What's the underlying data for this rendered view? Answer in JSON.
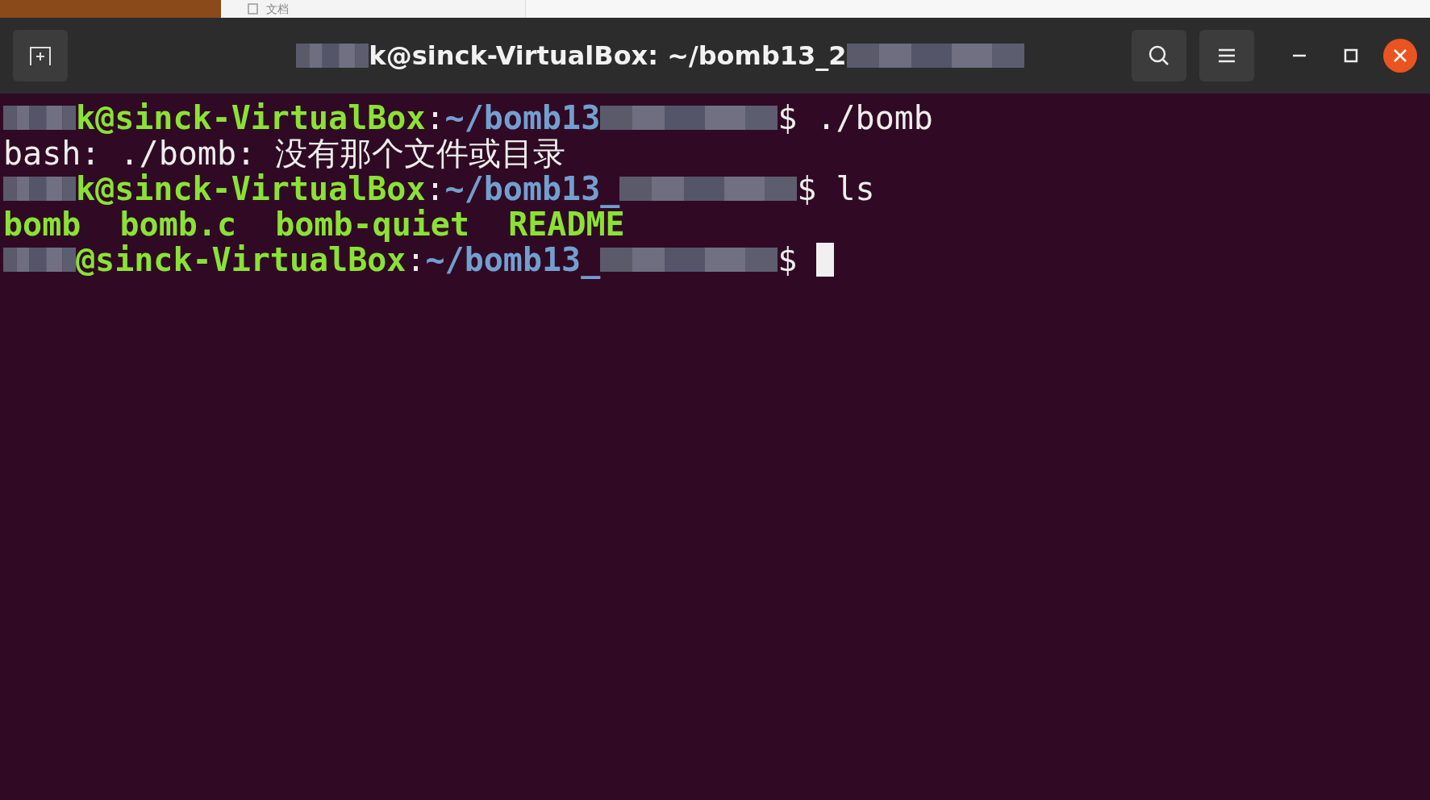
{
  "background_window": {
    "label": "文档"
  },
  "window": {
    "title": [
      {
        "kind": "redaction"
      },
      {
        "kind": "text",
        "text": "k@sinck-VirtualBox: ~/bomb13_2"
      },
      {
        "kind": "redaction"
      }
    ]
  },
  "terminal": {
    "lines": [
      {
        "segments": [
          {
            "kind": "redaction"
          },
          {
            "kind": "user",
            "text": "k@sinck-VirtualBox"
          },
          {
            "kind": "plain",
            "text": ":"
          },
          {
            "kind": "path",
            "text": "~/bomb13"
          },
          {
            "kind": "redaction"
          },
          {
            "kind": "plain",
            "text": "$ ./bomb"
          }
        ]
      },
      {
        "segments": [
          {
            "kind": "plain",
            "text": "bash: ./bomb: 没有那个文件或目录"
          }
        ]
      },
      {
        "segments": [
          {
            "kind": "redaction"
          },
          {
            "kind": "user",
            "text": "k@sinck-VirtualBox"
          },
          {
            "kind": "plain",
            "text": ":"
          },
          {
            "kind": "path",
            "text": "~/bomb13_"
          },
          {
            "kind": "redaction"
          },
          {
            "kind": "plain",
            "text": "$ ls"
          }
        ]
      },
      {
        "segments": [
          {
            "kind": "user",
            "text": "bomb  bomb.c  bomb-quiet  README"
          }
        ]
      },
      {
        "segments": [
          {
            "kind": "redaction"
          },
          {
            "kind": "user",
            "text": "@sinck-VirtualBox"
          },
          {
            "kind": "plain",
            "text": ":"
          },
          {
            "kind": "path",
            "text": "~/bomb13_"
          },
          {
            "kind": "redaction"
          },
          {
            "kind": "plain",
            "text": "$ "
          },
          {
            "kind": "cursor"
          }
        ]
      }
    ]
  }
}
